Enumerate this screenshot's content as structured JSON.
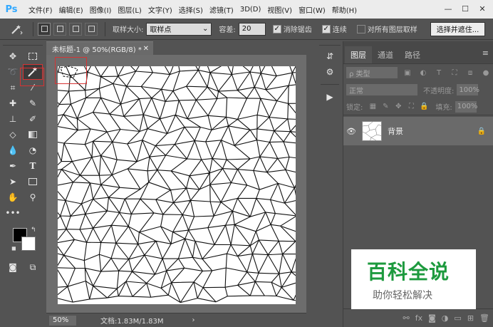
{
  "app": {
    "logo": "Ps"
  },
  "menu": [
    "文件(F)",
    "编辑(E)",
    "图像(I)",
    "图层(L)",
    "文字(Y)",
    "选择(S)",
    "滤镜(T)",
    "3D(D)",
    "视图(V)",
    "窗口(W)",
    "帮助(H)"
  ],
  "options": {
    "sample_size_label": "取样大小:",
    "sample_size_value": "取样点",
    "tolerance_label": "容差:",
    "tolerance_value": "20",
    "anti_alias_label": "消除锯齿",
    "anti_alias_checked": true,
    "contiguous_label": "连续",
    "contiguous_checked": true,
    "sample_all_layers_label": "对所有图层取样",
    "sample_all_layers_checked": false,
    "select_mask_button": "选择并遮住..."
  },
  "document": {
    "tab_title": "未标题-1 @ 50%(RGB/8) *",
    "zoom": "50%",
    "doc_info": "文档:1.83M/1.83M"
  },
  "layers_panel": {
    "tabs": [
      "图层",
      "通道",
      "路径"
    ],
    "filter_placeholder": "ρ 类型",
    "blend_mode": "正常",
    "opacity_label": "不透明度:",
    "opacity_value": "100%",
    "lock_label": "锁定:",
    "fill_label": "填充:",
    "fill_value": "100%",
    "layers": [
      {
        "name": "背景",
        "visible": true,
        "locked": true
      }
    ]
  },
  "watermark": {
    "title": "百科全说",
    "subtitle": "助你轻松解决"
  },
  "colors": {
    "accent_selection": "#d63333",
    "watermark_green": "#1d9a3e"
  }
}
